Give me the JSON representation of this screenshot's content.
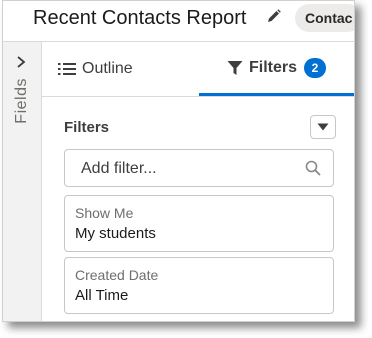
{
  "header": {
    "title": "Recent Contacts Report",
    "chip_label": "Contac"
  },
  "sidebar": {
    "fields_label": "Fields"
  },
  "tabs": [
    {
      "label": "Outline",
      "icon": "list-icon"
    },
    {
      "label": "Filters",
      "icon": "funnel-icon",
      "badge": "2"
    }
  ],
  "filters": {
    "heading": "Filters",
    "add_placeholder": "Add filter...",
    "items": [
      {
        "label": "Show Me",
        "value": "My students"
      },
      {
        "label": "Created Date",
        "value": "All Time"
      }
    ]
  },
  "colors": {
    "accent": "#0070d2",
    "panel_bg": "#f3f2f2",
    "border": "#dddbda"
  }
}
